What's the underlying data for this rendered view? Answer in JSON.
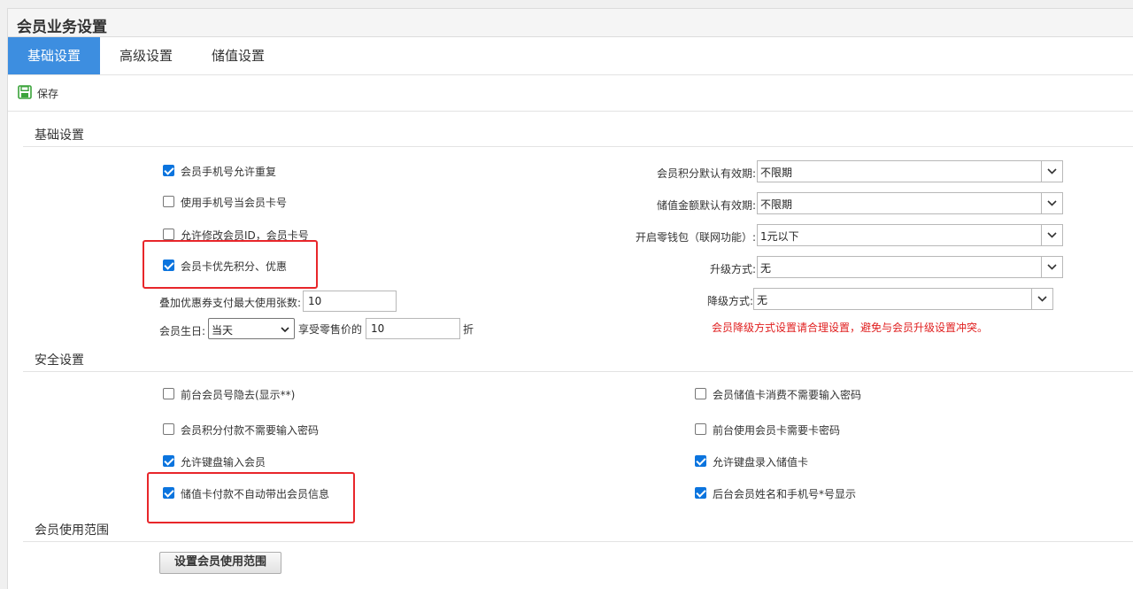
{
  "window": {
    "title": "会员业务设置"
  },
  "tabs": [
    {
      "label": "基础设置",
      "active": true
    },
    {
      "label": "高级设置",
      "active": false
    },
    {
      "label": "储值设置",
      "active": false
    }
  ],
  "toolbar": {
    "save_label": "保存",
    "save_icon": "save-icon"
  },
  "colors": {
    "accent": "#3d8ee0",
    "checkbox": "#0b74de",
    "warning": "#e02020",
    "highlight": "#e8262a"
  },
  "basic": {
    "heading": "基础设置",
    "checkboxes": [
      {
        "label": "会员手机号允许重复",
        "checked": true
      },
      {
        "label": "使用手机号当会员卡号",
        "checked": false
      },
      {
        "label": "允许修改会员ID，会员卡号",
        "checked": false
      },
      {
        "label": "会员卡优先积分、优惠",
        "checked": true
      }
    ],
    "coupon_limit": {
      "label": "叠加优惠券支付最大使用张数:",
      "value": "10"
    },
    "birthday": {
      "label": "会员生日:",
      "selected": "当天",
      "discount_label": "享受零售价的",
      "discount_value": "10",
      "discount_unit": "折"
    },
    "right": [
      {
        "label": "会员积分默认有效期:",
        "value": "不限期"
      },
      {
        "label": "储值金额默认有效期:",
        "value": "不限期"
      },
      {
        "label": "开启零钱包（联网功能）:",
        "value": "1元以下"
      },
      {
        "label": "升级方式:",
        "value": "无"
      },
      {
        "label": "降级方式:",
        "value": "无"
      }
    ],
    "warning": "会员降级方式设置请合理设置，避免与会员升级设置冲突。"
  },
  "security": {
    "heading": "安全设置",
    "left": [
      {
        "label": "前台会员号隐去(显示**)",
        "checked": false
      },
      {
        "label": "会员积分付款不需要输入密码",
        "checked": false
      },
      {
        "label": "允许键盘输入会员",
        "checked": true
      },
      {
        "label": "储值卡付款不自动带出会员信息",
        "checked": true
      }
    ],
    "right": [
      {
        "label": "会员储值卡消费不需要输入密码",
        "checked": false
      },
      {
        "label": "前台使用会员卡需要卡密码",
        "checked": false
      },
      {
        "label": "允许键盘录入储值卡",
        "checked": true
      },
      {
        "label": "后台会员姓名和手机号*号显示",
        "checked": true
      }
    ]
  },
  "scope": {
    "heading": "会员使用范围",
    "button_label": "设置会员使用范围"
  }
}
